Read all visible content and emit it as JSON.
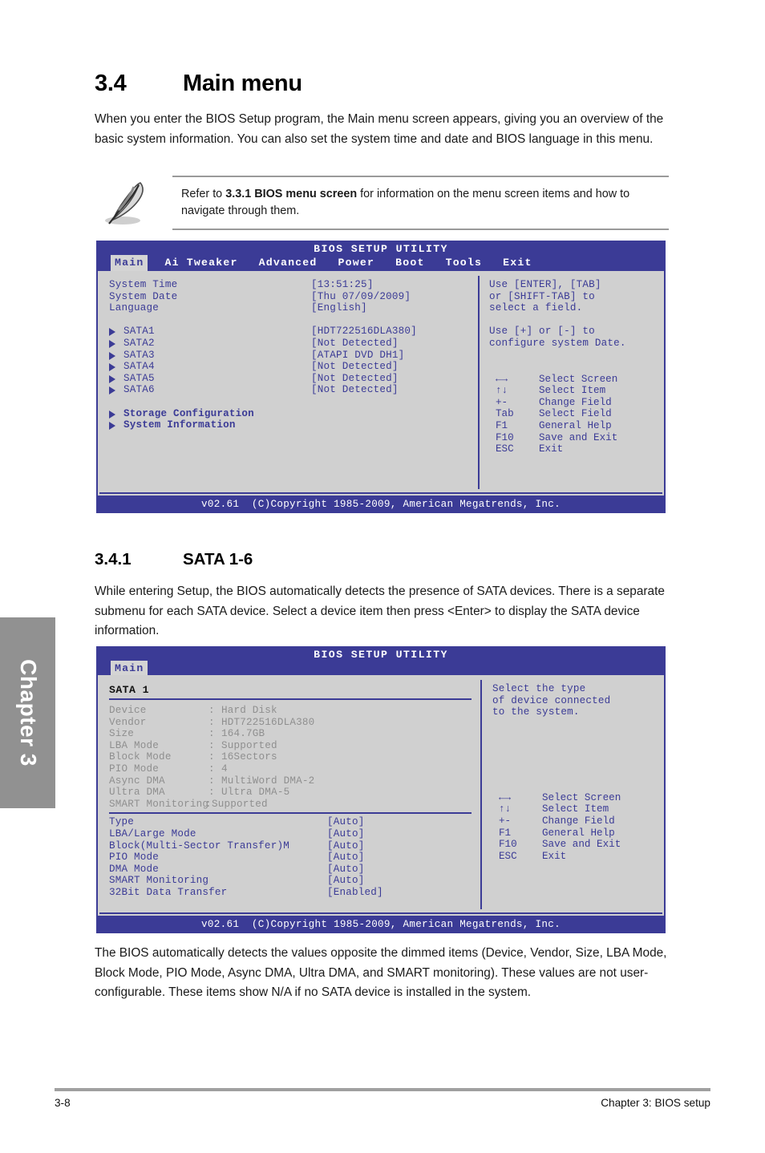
{
  "chapter_tab": {
    "label": "Chapter 3"
  },
  "section": {
    "number": "3.4",
    "title": "Main menu",
    "intro": "When you enter the BIOS Setup program, the Main menu screen appears, giving you an overview of the basic system information. You can also set the system time and date and BIOS language in this menu."
  },
  "note": {
    "icon": "pencil-note-icon",
    "prefix": "Refer to ",
    "bold": "3.3.1 BIOS menu screen",
    "suffix": " for information on the menu screen items and how to navigate through them."
  },
  "bios_main": {
    "title": "BIOS SETUP UTILITY",
    "tabs": [
      {
        "label": "Main",
        "active": true
      },
      {
        "label": "Ai Tweaker",
        "active": false
      },
      {
        "label": "Advanced",
        "active": false
      },
      {
        "label": "Power",
        "active": false
      },
      {
        "label": "Boot",
        "active": false
      },
      {
        "label": "Tools",
        "active": false
      },
      {
        "label": "Exit",
        "active": false
      }
    ],
    "items": [
      {
        "label": "System Time",
        "value": "[13:51:25]",
        "bullet": false,
        "bold": false
      },
      {
        "label": "System Date",
        "value": "[Thu 07/09/2009]",
        "bullet": false,
        "bold": false
      },
      {
        "label": "Language",
        "value": "[English]",
        "bullet": false,
        "bold": false
      },
      {
        "label": "SATA1",
        "value": "[HDT722516DLA380]",
        "bullet": true,
        "bold": false
      },
      {
        "label": "SATA2",
        "value": "[Not Detected]",
        "bullet": true,
        "bold": false
      },
      {
        "label": "SATA3",
        "value": "[ATAPI DVD DH1]",
        "bullet": true,
        "bold": false
      },
      {
        "label": "SATA4",
        "value": "[Not Detected]",
        "bullet": true,
        "bold": false
      },
      {
        "label": "SATA5",
        "value": "[Not Detected]",
        "bullet": true,
        "bold": false
      },
      {
        "label": "SATA6",
        "value": "[Not Detected]",
        "bullet": true,
        "bold": false
      },
      {
        "label": "Storage Configuration",
        "value": "",
        "bullet": true,
        "bold": true
      },
      {
        "label": "System Information",
        "value": "",
        "bullet": true,
        "bold": true
      }
    ],
    "help_lines": [
      "Use [ENTER], [TAB]",
      "or [SHIFT-TAB] to",
      "select a field.",
      "",
      "Use [+] or [-] to",
      "configure system Date."
    ],
    "keys": [
      {
        "key": "←→",
        "desc": "Select Screen"
      },
      {
        "key": "↑↓",
        "desc": "Select Item"
      },
      {
        "key": "+-",
        "desc": "Change Field"
      },
      {
        "key": "Tab",
        "desc": "Select Field"
      },
      {
        "key": "F1",
        "desc": "General Help"
      },
      {
        "key": "F10",
        "desc": "Save and Exit"
      },
      {
        "key": "ESC",
        "desc": "Exit"
      }
    ],
    "footer": "v02.61  (C)Copyright 1985-2009, American Megatrends, Inc."
  },
  "subsection": {
    "number": "3.4.1",
    "title": "SATA 1-6",
    "intro": "While entering Setup, the BIOS automatically detects the presence of SATA devices. There is a separate submenu for each SATA device. Select a device item then press <Enter> to display the SATA device information."
  },
  "bios_sata": {
    "title": "BIOS SETUP UTILITY",
    "tabs": [
      {
        "label": "Main",
        "active": true
      }
    ],
    "panel_heading": "SATA 1",
    "info": [
      {
        "label": "Device",
        "sep": ":",
        "value": "Hard Disk"
      },
      {
        "label": "Vendor",
        "sep": ":",
        "value": "HDT722516DLA380"
      },
      {
        "label": "Size",
        "sep": ":",
        "value": "164.7GB"
      },
      {
        "label": "LBA Mode",
        "sep": ":",
        "value": "Supported"
      },
      {
        "label": "Block Mode",
        "sep": ":",
        "value": "16Sectors"
      },
      {
        "label": "PIO Mode",
        "sep": ":",
        "value": "4"
      },
      {
        "label": "Async DMA",
        "sep": ":",
        "value": "MultiWord DMA-2"
      },
      {
        "label": "Ultra DMA",
        "sep": ":",
        "value": "Ultra DMA-5"
      },
      {
        "label": "SMART Monitoring",
        "sep": ":",
        "value": "Supported"
      }
    ],
    "settings": [
      {
        "label": "Type",
        "value": "[Auto]"
      },
      {
        "label": "LBA/Large Mode",
        "value": "[Auto]"
      },
      {
        "label": "Block(Multi-Sector Transfer)M",
        "value": "[Auto]"
      },
      {
        "label": "PIO Mode",
        "value": "[Auto]"
      },
      {
        "label": "DMA Mode",
        "value": "[Auto]"
      },
      {
        "label": "SMART Monitoring",
        "value": "[Auto]"
      },
      {
        "label": "32Bit Data Transfer",
        "value": "[Enabled]"
      }
    ],
    "help_lines": [
      "Select the type",
      "of device connected",
      "to the system."
    ],
    "keys": [
      {
        "key": "←→",
        "desc": "Select Screen"
      },
      {
        "key": "↑↓",
        "desc": "Select Item"
      },
      {
        "key": "+-",
        "desc": "Change Field"
      },
      {
        "key": "F1",
        "desc": "General Help"
      },
      {
        "key": "F10",
        "desc": "Save and Exit"
      },
      {
        "key": "ESC",
        "desc": "Exit"
      }
    ],
    "footer": "v02.61  (C)Copyright 1985-2009, American Megatrends, Inc."
  },
  "closing_para": "The BIOS automatically detects the values opposite the dimmed items (Device, Vendor, Size, LBA Mode, Block Mode, PIO Mode, Async DMA, Ultra DMA, and SMART monitoring). These values are not user-configurable. These items show N/A if no SATA device is installed in the system.",
  "page_footer": {
    "page_number": "3-8",
    "chapter_label": "Chapter 3: BIOS setup"
  },
  "colors": {
    "bios_blue": "#3b3b96",
    "bios_gray": "#d0d0d0",
    "chapter_tab_gray": "#919191",
    "dimmed_text": "#8f8f8f"
  }
}
